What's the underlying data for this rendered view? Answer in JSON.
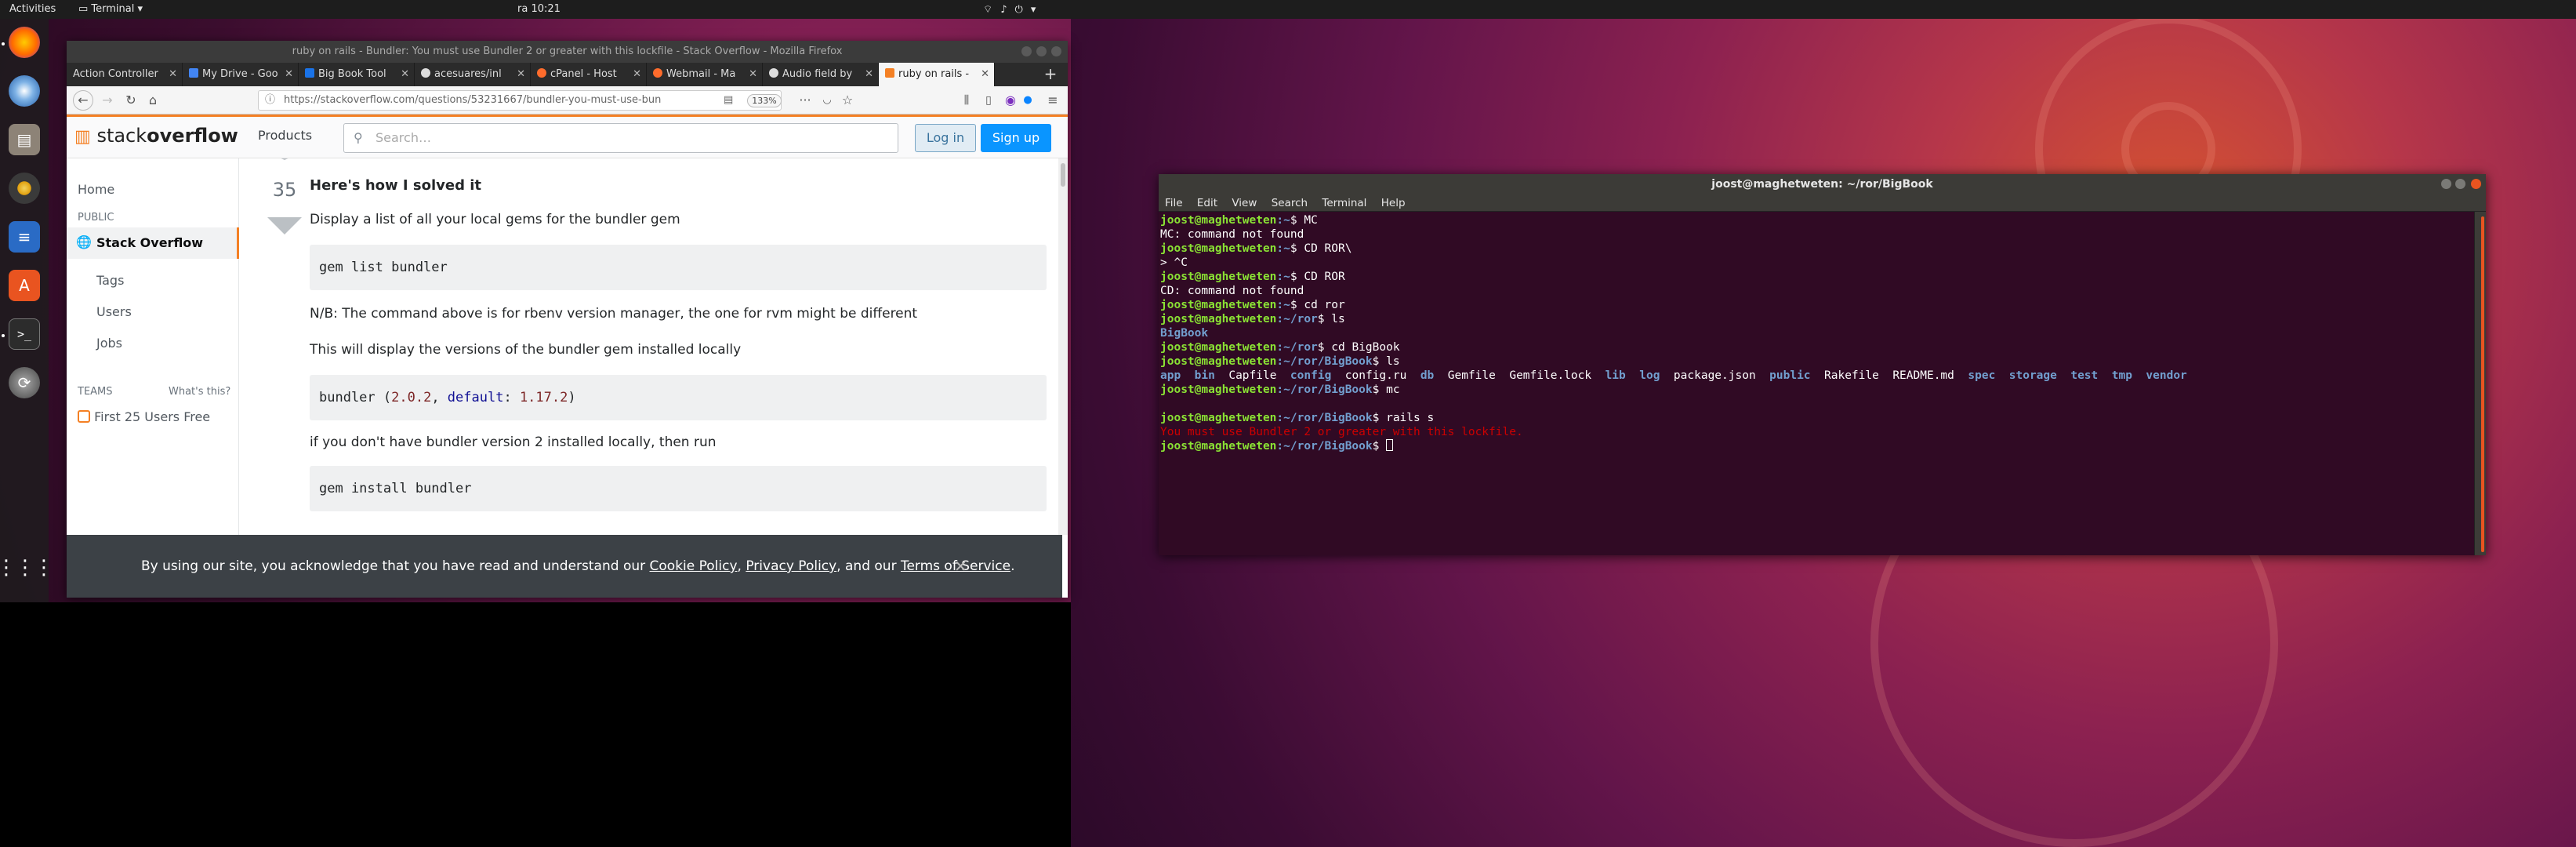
{
  "topbar": {
    "activities": "Activities",
    "app_menu": "Terminal",
    "clock": "ra 10:21"
  },
  "dock": {
    "icons": [
      "firefox-icon",
      "thunderbird-icon",
      "files-icon",
      "rhythmbox-icon",
      "writer-icon",
      "software-icon",
      "terminal-icon",
      "update-icon",
      "show-apps-icon"
    ]
  },
  "firefox": {
    "window_title": "ruby on rails - Bundler: You must use Bundler 2 or greater with this lockfile - Stack Overflow - Mozilla Firefox",
    "tabs": [
      {
        "label": "Action Controller",
        "color": "#cc0000"
      },
      {
        "label": "My Drive - Goo",
        "color": "#4285f4"
      },
      {
        "label": "Big Book Tool",
        "color": "#1a73e8"
      },
      {
        "label": "acesuares/inl",
        "color": "#222222"
      },
      {
        "label": "cPanel - Host",
        "color": "#ff6c2c"
      },
      {
        "label": "Webmail - Ma",
        "color": "#ff6c2c"
      },
      {
        "label": "Audio field by",
        "color": "#222222"
      },
      {
        "label": "ruby on rails -",
        "color": "#f48024"
      }
    ],
    "url": "https://stackoverflow.com/questions/53231667/bundler-you-must-use-bun",
    "zoom": "133%"
  },
  "so": {
    "logo_a": "stack",
    "logo_b": "overflow",
    "products": "Products",
    "search_placeholder": "Search…",
    "login": "Log in",
    "signup": "Sign up",
    "nav": {
      "home": "Home",
      "public": "PUBLIC",
      "stackoverflow": "Stack Overflow",
      "tags": "Tags",
      "users": "Users",
      "jobs": "Jobs",
      "teams": "TEAMS",
      "whats_this": "What's this?",
      "teams_free": "First 25 Users Free"
    },
    "answer": {
      "votes": "35",
      "heading": "Here's how I solved it",
      "p1": "Display a list of all your local gems for the bundler gem",
      "code1": "gem list bundler",
      "p2": "N/B: The command above is for rbenv version manager, the one for rvm might be different",
      "p3": "This will display the versions of the bundler gem installed locally",
      "code2_a": "bundler (",
      "code2_v1": "2.0.2",
      "code2_b": ", ",
      "code2_kw": "default",
      "code2_c": ": ",
      "code2_v2": "1.17.2",
      "code2_d": ")",
      "p4": "if you don't have bundler version 2 installed locally, then run",
      "code3": "gem install bundler"
    },
    "cookie": {
      "text_a": "By using our site, you acknowledge that you have read and understand our ",
      "link1": "Cookie Policy",
      "sep1": ", ",
      "link2": "Privacy Policy",
      "sep2": ", and our ",
      "link3": "Terms of Service",
      "end": "."
    }
  },
  "terminal": {
    "title": "joost@maghetweten: ~/ror/BigBook",
    "menu": [
      "File",
      "Edit",
      "View",
      "Search",
      "Terminal",
      "Help"
    ],
    "user": "joost@maghetweten",
    "lines": [
      {
        "path": ":~",
        "cmd": "$ MC"
      },
      {
        "out": "MC: command not found"
      },
      {
        "path": ":~",
        "cmd": "$ CD ROR\\"
      },
      {
        "out": "> ^C"
      },
      {
        "path": ":~",
        "cmd": "$ CD ROR"
      },
      {
        "out": "CD: command not found"
      },
      {
        "path": ":~",
        "cmd": "$ cd ror"
      },
      {
        "path": ":~/ror",
        "cmd": "$ ls"
      },
      {
        "dirout": "BigBook"
      },
      {
        "path": ":~/ror",
        "cmd": "$ cd BigBook"
      },
      {
        "path": ":~/ror/BigBook",
        "cmd": "$ ls"
      },
      {
        "ls": true
      },
      {
        "path": ":~/ror/BigBook",
        "cmd": "$ mc"
      },
      {
        "blank": true
      },
      {
        "path": ":~/ror/BigBook",
        "cmd": "$ rails s"
      },
      {
        "err": "You must use Bundler 2 or greater with this lockfile."
      },
      {
        "path": ":~/ror/BigBook",
        "cmd": "$ ",
        "cursor": true
      }
    ],
    "ls_items": [
      {
        "name": "app",
        "dir": true
      },
      {
        "name": "bin",
        "dir": true
      },
      {
        "name": "Capfile",
        "dir": false
      },
      {
        "name": "config",
        "dir": true
      },
      {
        "name": "config.ru",
        "dir": false
      },
      {
        "name": "db",
        "dir": true
      },
      {
        "name": "Gemfile",
        "dir": false
      },
      {
        "name": "Gemfile.lock",
        "dir": false
      },
      {
        "name": "lib",
        "dir": true
      },
      {
        "name": "log",
        "dir": true
      },
      {
        "name": "package.json",
        "dir": false
      },
      {
        "name": "public",
        "dir": true
      },
      {
        "name": "Rakefile",
        "dir": false
      },
      {
        "name": "README.md",
        "dir": false
      },
      {
        "name": "spec",
        "dir": true
      },
      {
        "name": "storage",
        "dir": true
      },
      {
        "name": "test",
        "dir": true
      },
      {
        "name": "tmp",
        "dir": true
      },
      {
        "name": "vendor",
        "dir": true
      }
    ]
  }
}
